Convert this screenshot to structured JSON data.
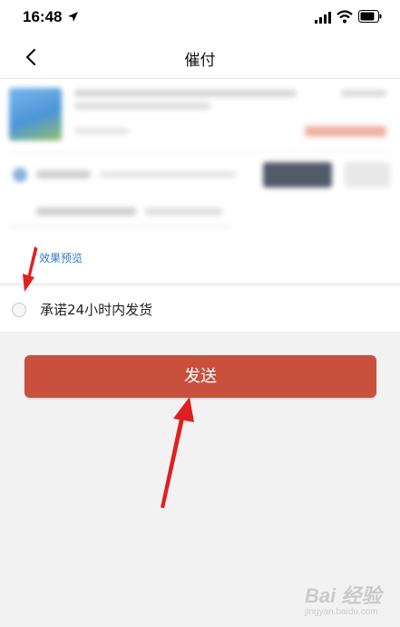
{
  "status_bar": {
    "time": "16:48"
  },
  "nav": {
    "title": "催付",
    "back_icon": "chevron-left-icon"
  },
  "preview": {
    "link_label": "效果预览"
  },
  "promise": {
    "label": "承诺24小时内发货",
    "checked": false
  },
  "send_button": {
    "label": "发送",
    "color": "#c9503d"
  },
  "watermark": {
    "logo": "Bai 经验",
    "url": "jingyan.baidu.com"
  },
  "colors": {
    "accent": "#c9503d",
    "link": "#3a78c9",
    "annotation_arrow": "#e02020"
  }
}
